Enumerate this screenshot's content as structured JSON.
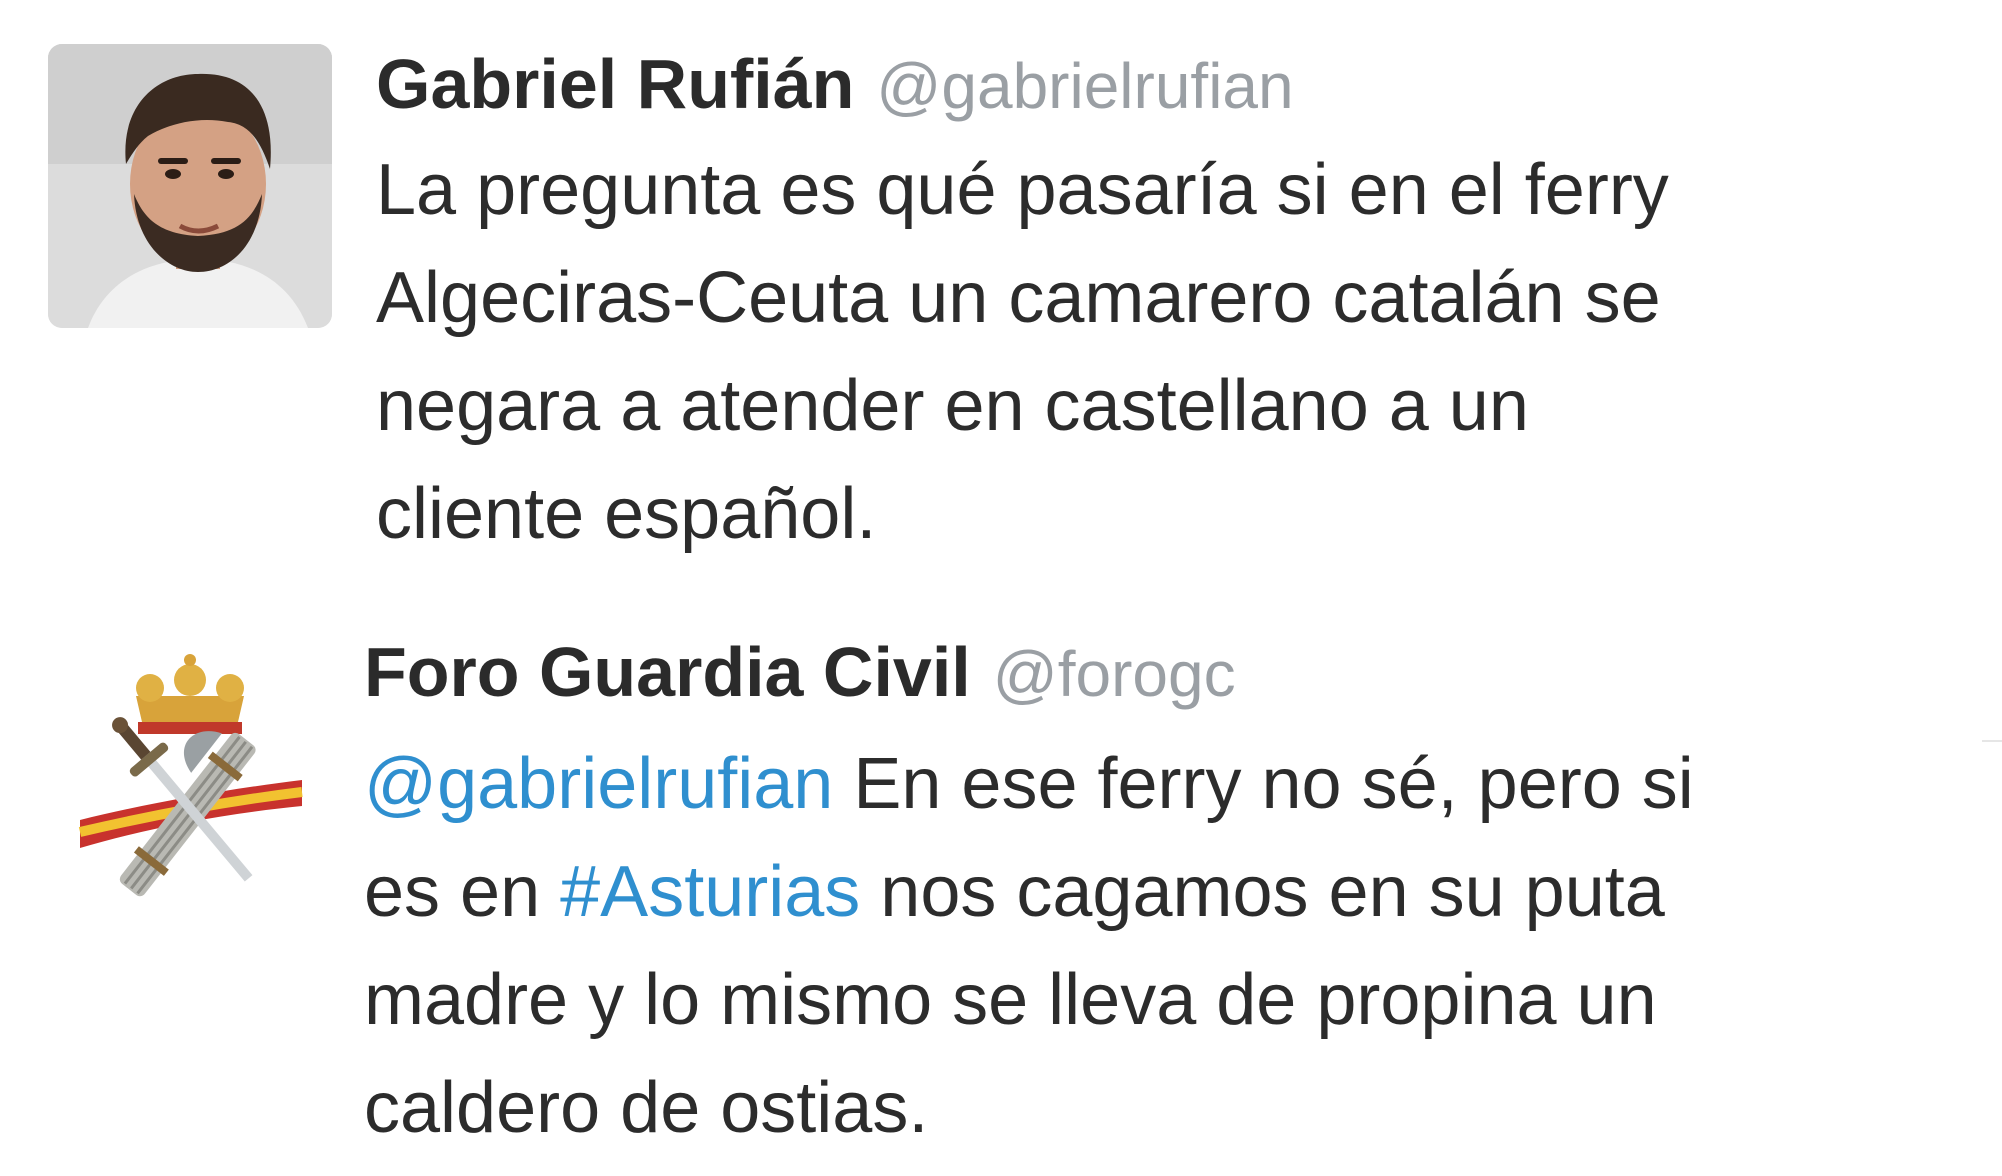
{
  "tweets": [
    {
      "author": {
        "name": "Gabriel Rufián",
        "handle": "@gabrielrufian",
        "avatar_icon": "person-photo"
      },
      "text_lines": [
        "La pregunta es qué pasaría si en el ferry",
        "Algeciras-Ceuta un camarero catalán se",
        "negara a atender en castellano a un",
        "cliente español."
      ]
    },
    {
      "author": {
        "name": "Foro Guardia Civil",
        "handle": "@forogc",
        "avatar_icon": "guardia-civil-emblem"
      },
      "text_lines": [
        {
          "mention": "@gabrielrufian",
          "rest": " En ese ferry no sé, pero si"
        },
        {
          "before": "es en ",
          "hashtag": "#Asturias",
          "after": " nos cagamos en su puta"
        },
        "madre y lo mismo se lleva de propina un",
        "caldero de ostias."
      ]
    }
  ],
  "colors": {
    "text": "#2c2c2c",
    "handle": "#9a9fa4",
    "link": "#2f8fcf",
    "background": "#ffffff"
  }
}
